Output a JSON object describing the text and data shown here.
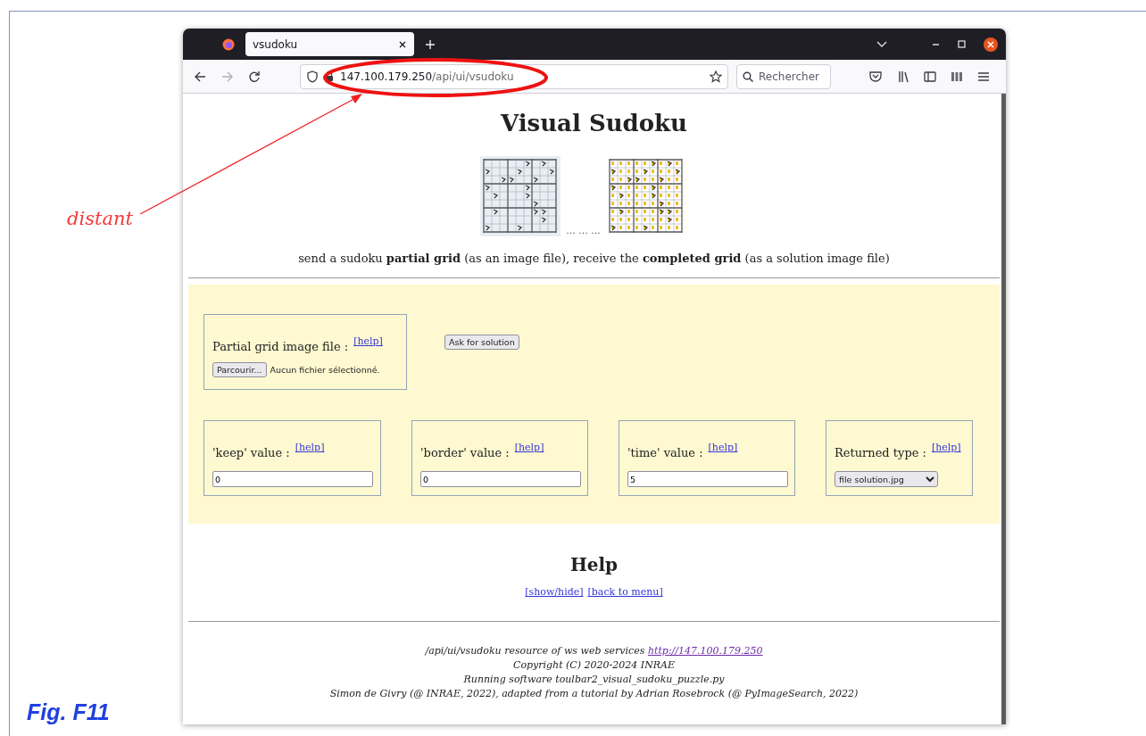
{
  "figure": {
    "label": "Fig. F11",
    "annotation": "distant"
  },
  "browser": {
    "tab": {
      "title": "vsudoku",
      "selected": true
    },
    "url": {
      "host": "147.100.179.250",
      "path": "/api/ui/vsudoku"
    },
    "search": {
      "placeholder": "Rechercher"
    }
  },
  "page": {
    "title": "Visual Sudoku",
    "images_separator": "... ... ...",
    "intro": "send a sudoku **partial grid** (as an image file), receive the **completed grid** (as a solution image file)",
    "upload": {
      "label": "Partial grid image file :",
      "help": "[help]",
      "browse_button": "Parcourir...",
      "file_status": "Aucun fichier sélectionné."
    },
    "submit_button": "Ask for solution",
    "params": [
      {
        "kind": "number",
        "label": "'keep' value :",
        "help": "[help]",
        "value": "0"
      },
      {
        "kind": "number",
        "label": "'border' value :",
        "help": "[help]",
        "value": "0"
      },
      {
        "kind": "number",
        "label": "'time' value :",
        "help": "[help]",
        "value": "5"
      },
      {
        "kind": "select",
        "label": "Returned type :",
        "help": "[help]",
        "value": "file solution.jpg"
      }
    ],
    "help": {
      "title": "Help",
      "links": [
        "[show/hide]",
        "[back to menu]"
      ]
    },
    "footer": {
      "resource_text": "/api/ui/vsudoku resource of ws web services",
      "resource_link": "http://147.100.179.250",
      "lines": [
        "Copyright (C) 2020-2024 INRAE",
        "Running software toulbar2_visual_sudoku_puzzle.py",
        "Simon de Givry (@ INRAE, 2022), adapted from a tutorial by Adrian Rosebrock (@ PyImageSearch, 2022)"
      ]
    }
  }
}
